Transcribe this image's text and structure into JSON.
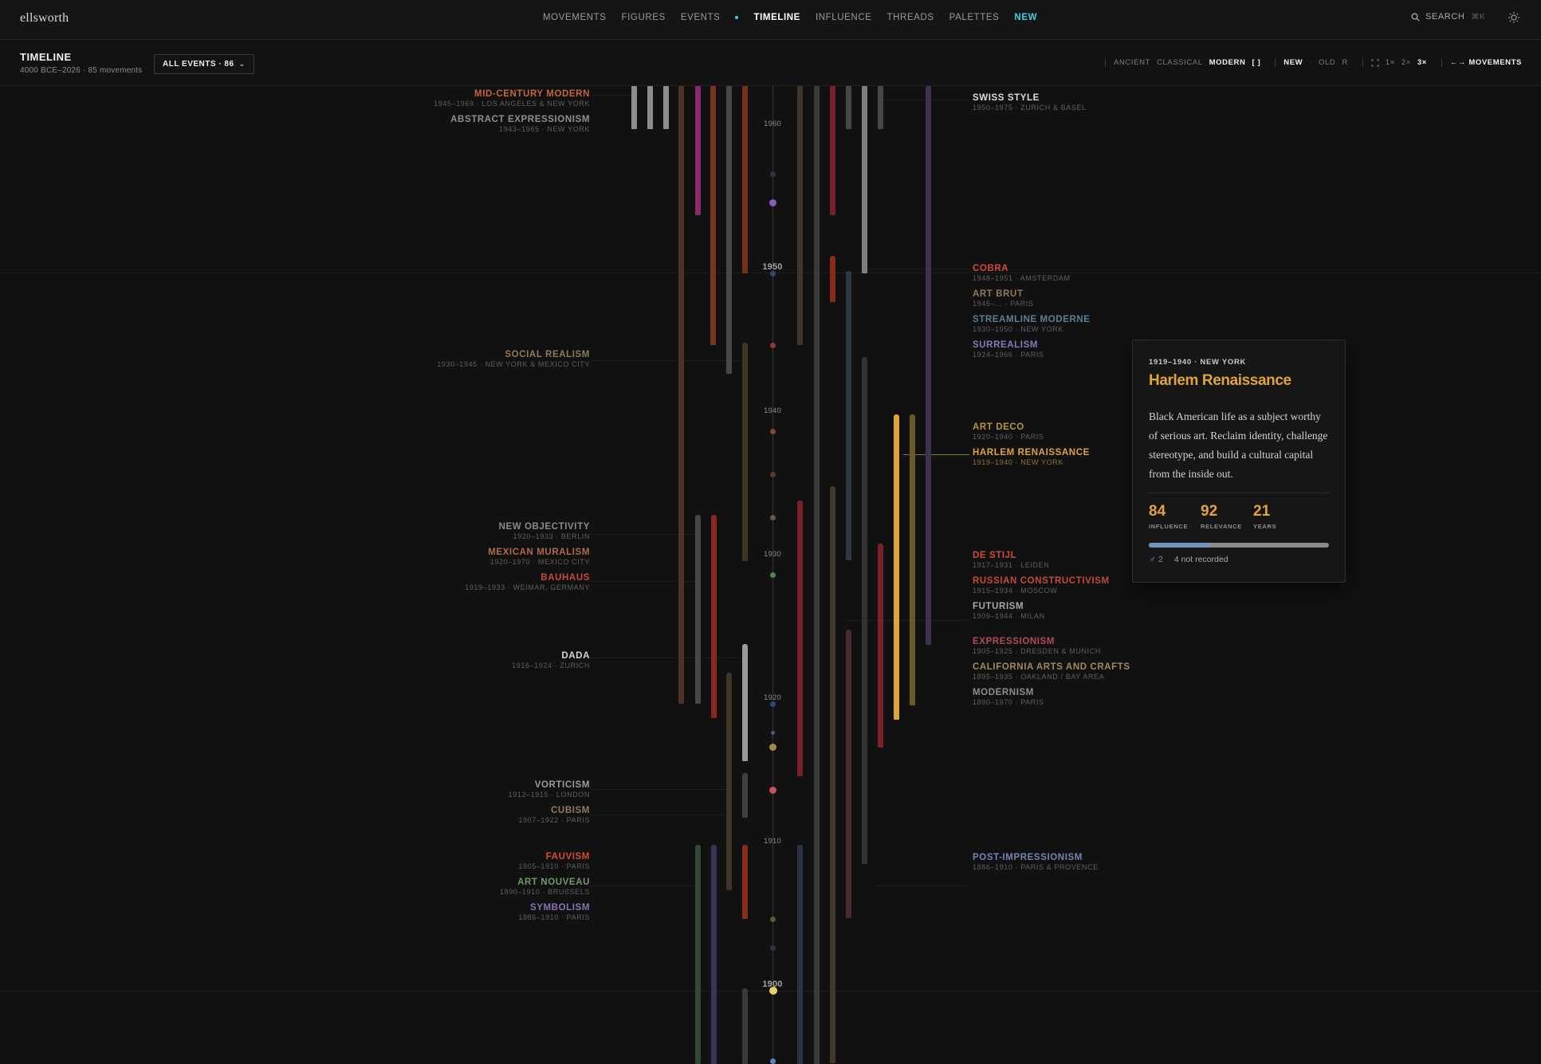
{
  "app": {
    "logo": "ellsworth"
  },
  "nav": {
    "items": [
      {
        "label": "MOVEMENTS",
        "state": ""
      },
      {
        "label": "FIGURES",
        "state": ""
      },
      {
        "label": "EVENTS",
        "state": ""
      },
      {
        "label": "TIMELINE",
        "state": "active"
      },
      {
        "label": "INFLUENCE",
        "state": ""
      },
      {
        "label": "THREADS",
        "state": ""
      },
      {
        "label": "PALETTES",
        "state": ""
      },
      {
        "label": "NEW",
        "state": "new"
      }
    ],
    "search_label": "SEARCH",
    "search_shortcut": "⌘K"
  },
  "subheader": {
    "title": "TIMELINE",
    "subtitle": "4000 BCE–2026 · 85 movements",
    "events_filter": "ALL EVENTS · 86",
    "eras": [
      "ANCIENT",
      "CLASSICAL",
      "MODERN"
    ],
    "active_era": "MODERN",
    "era_key": "[ ]",
    "order": [
      "NEW",
      "OLD"
    ],
    "active_order": "NEW",
    "order_key": "R",
    "zoom": [
      "1×",
      "2×",
      "3×"
    ],
    "active_zoom": "3×",
    "movements_toggle": "←→ MOVEMENTS"
  },
  "timeline": {
    "years": [
      {
        "label": "1960",
        "major": false
      },
      {
        "label": "1950",
        "major": true
      },
      {
        "label": "1940",
        "major": false
      },
      {
        "label": "1930",
        "major": false
      },
      {
        "label": "1920",
        "major": false
      },
      {
        "label": "1910",
        "major": false
      },
      {
        "label": "1900",
        "major": true
      }
    ],
    "movements_left": [
      {
        "name": "MID-CENTURY MODERN",
        "meta": "1945–1969 · LOS ANGELES & NEW YORK",
        "color": "#c4653a"
      },
      {
        "name": "ABSTRACT EXPRESSIONISM",
        "meta": "1943–1965 · NEW YORK",
        "color": "#8f8f8f"
      },
      {
        "name": "SOCIAL REALISM",
        "meta": "1930–1945 · NEW YORK & MEXICO CITY",
        "color": "#8e7a58"
      },
      {
        "name": "NEW OBJECTIVITY",
        "meta": "1920–1933 · BERLIN",
        "color": "#8a8a8a"
      },
      {
        "name": "MEXICAN MURALISM",
        "meta": "1920–1970 · MEXICO CITY",
        "color": "#b06a4a"
      },
      {
        "name": "BAUHAUS",
        "meta": "1919–1933 · WEIMAR, GERMANY",
        "color": "#c7483e"
      },
      {
        "name": "DADA",
        "meta": "1916–1924 · ZURICH",
        "color": "#d4d4d4"
      },
      {
        "name": "VORTICISM",
        "meta": "1912–1915 · LONDON",
        "color": "#9a9a9a"
      },
      {
        "name": "CUBISM",
        "meta": "1907–1922 · PARIS",
        "color": "#927c5a"
      },
      {
        "name": "FAUVISM",
        "meta": "1905–1910 · PARIS",
        "color": "#d2502e"
      },
      {
        "name": "ART NOUVEAU",
        "meta": "1890–1910 · BRUSSELS",
        "color": "#6f9a6a"
      },
      {
        "name": "SYMBOLISM",
        "meta": "1886–1910 · PARIS",
        "color": "#8a72b8"
      }
    ],
    "movements_right": [
      {
        "name": "SWISS STYLE",
        "meta": "1950–1975 · ZURICH & BASEL",
        "color": "#dcdcdc"
      },
      {
        "name": "COBRA",
        "meta": "1948–1951 · AMSTERDAM",
        "color": "#d64a35"
      },
      {
        "name": "ART BRUT",
        "meta": "1945–... · PARIS",
        "color": "#8e7a58"
      },
      {
        "name": "STREAMLINE MODERNE",
        "meta": "1930–1950 · NEW YORK",
        "color": "#5f7d92"
      },
      {
        "name": "SURREALISM",
        "meta": "1924–1966 · PARIS",
        "color": "#8b76b8"
      },
      {
        "name": "ART DECO",
        "meta": "1920–1940 · PARIS",
        "color": "#b6963c"
      },
      {
        "name": "HARLEM RENAISSANCE",
        "meta": "1919–1940 · NEW YORK",
        "color": "#e0a43a"
      },
      {
        "name": "DE STIJL",
        "meta": "1917–1931 · LEIDEN",
        "color": "#d04a3a"
      },
      {
        "name": "RUSSIAN CONSTRUCTIVISM",
        "meta": "1915–1934 · MOSCOW",
        "color": "#c44a3a"
      },
      {
        "name": "FUTURISM",
        "meta": "1909–1944 · MILAN",
        "color": "#a8a8a8"
      },
      {
        "name": "EXPRESSIONISM",
        "meta": "1905–1925 · DRESDEN & MUNICH",
        "color": "#b44a58"
      },
      {
        "name": "CALIFORNIA ARTS AND CRAFTS",
        "meta": "1895–1935 · OAKLAND / BAY AREA",
        "color": "#a08a5a"
      },
      {
        "name": "MODERNISM",
        "meta": "1890–1970 · PARIS",
        "color": "#8e8e8e"
      },
      {
        "name": "POST-IMPRESSIONISM",
        "meta": "1886–1910 · PARIS & PROVENCE",
        "color": "#6f86b0"
      }
    ]
  },
  "detail": {
    "meta": "1919–1940 · NEW YORK",
    "title": "Harlem Renaissance",
    "description": "Black American life as a subject worthy of serious art. Reclaim identity, challenge stereotype, and build a cultural capital from the inside out.",
    "stats": [
      {
        "value": "84",
        "label": "INFLUENCE"
      },
      {
        "value": "92",
        "label": "RELEVANCE"
      },
      {
        "value": "21",
        "label": "YEARS"
      }
    ],
    "gender_fraction": 0.34,
    "figures_count": "2",
    "not_recorded": "4 not recorded",
    "accent": "#e0a43a"
  }
}
